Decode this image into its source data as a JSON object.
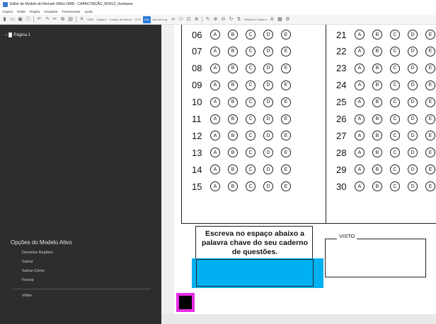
{
  "window": {
    "title": "Editor de Modelo do Remark Office OMR - CAPACITAÇÃO_RO012_Vestiavee"
  },
  "menu": [
    "Arquivo",
    "Editar",
    "Região",
    "Visualizar",
    "Ferramentas",
    "Ajuda"
  ],
  "toolbar": {
    "omr_label": "OMR",
    "image_label": "Imagem",
    "barcode_label": "Código de Barras",
    "ocr_label": "OCR",
    "active_label": "Sxs",
    "handwriting_label": "Anexar Img.",
    "region_image_label": "Registrar Imagem",
    "active_color": "#2b7bd6"
  },
  "sidebar": {
    "tree": [
      {
        "label": "Página 1"
      }
    ],
    "options_title": "Opções do Modelo Ativo",
    "options": [
      "Desenhe Regiões",
      "Salvar",
      "Salvar Como",
      "Fechar"
    ],
    "back": "Voltar",
    "bg_color": "#2d2d2d"
  },
  "form": {
    "choices": [
      "A",
      "B",
      "C",
      "D",
      "E"
    ],
    "left_questions": [
      "06",
      "07",
      "08",
      "09",
      "10",
      "11",
      "12",
      "13",
      "14",
      "15"
    ],
    "right_questions": [
      "21",
      "22",
      "23",
      "24",
      "25",
      "26",
      "27",
      "28",
      "29",
      "30"
    ],
    "instruction": "Escreva no espaço abaixo a palavra chave do seu caderno de questões.",
    "visto_label": "VISTO",
    "answer_field_color": "#00b0f0",
    "anchor_selection_color": "#e62ee6"
  }
}
